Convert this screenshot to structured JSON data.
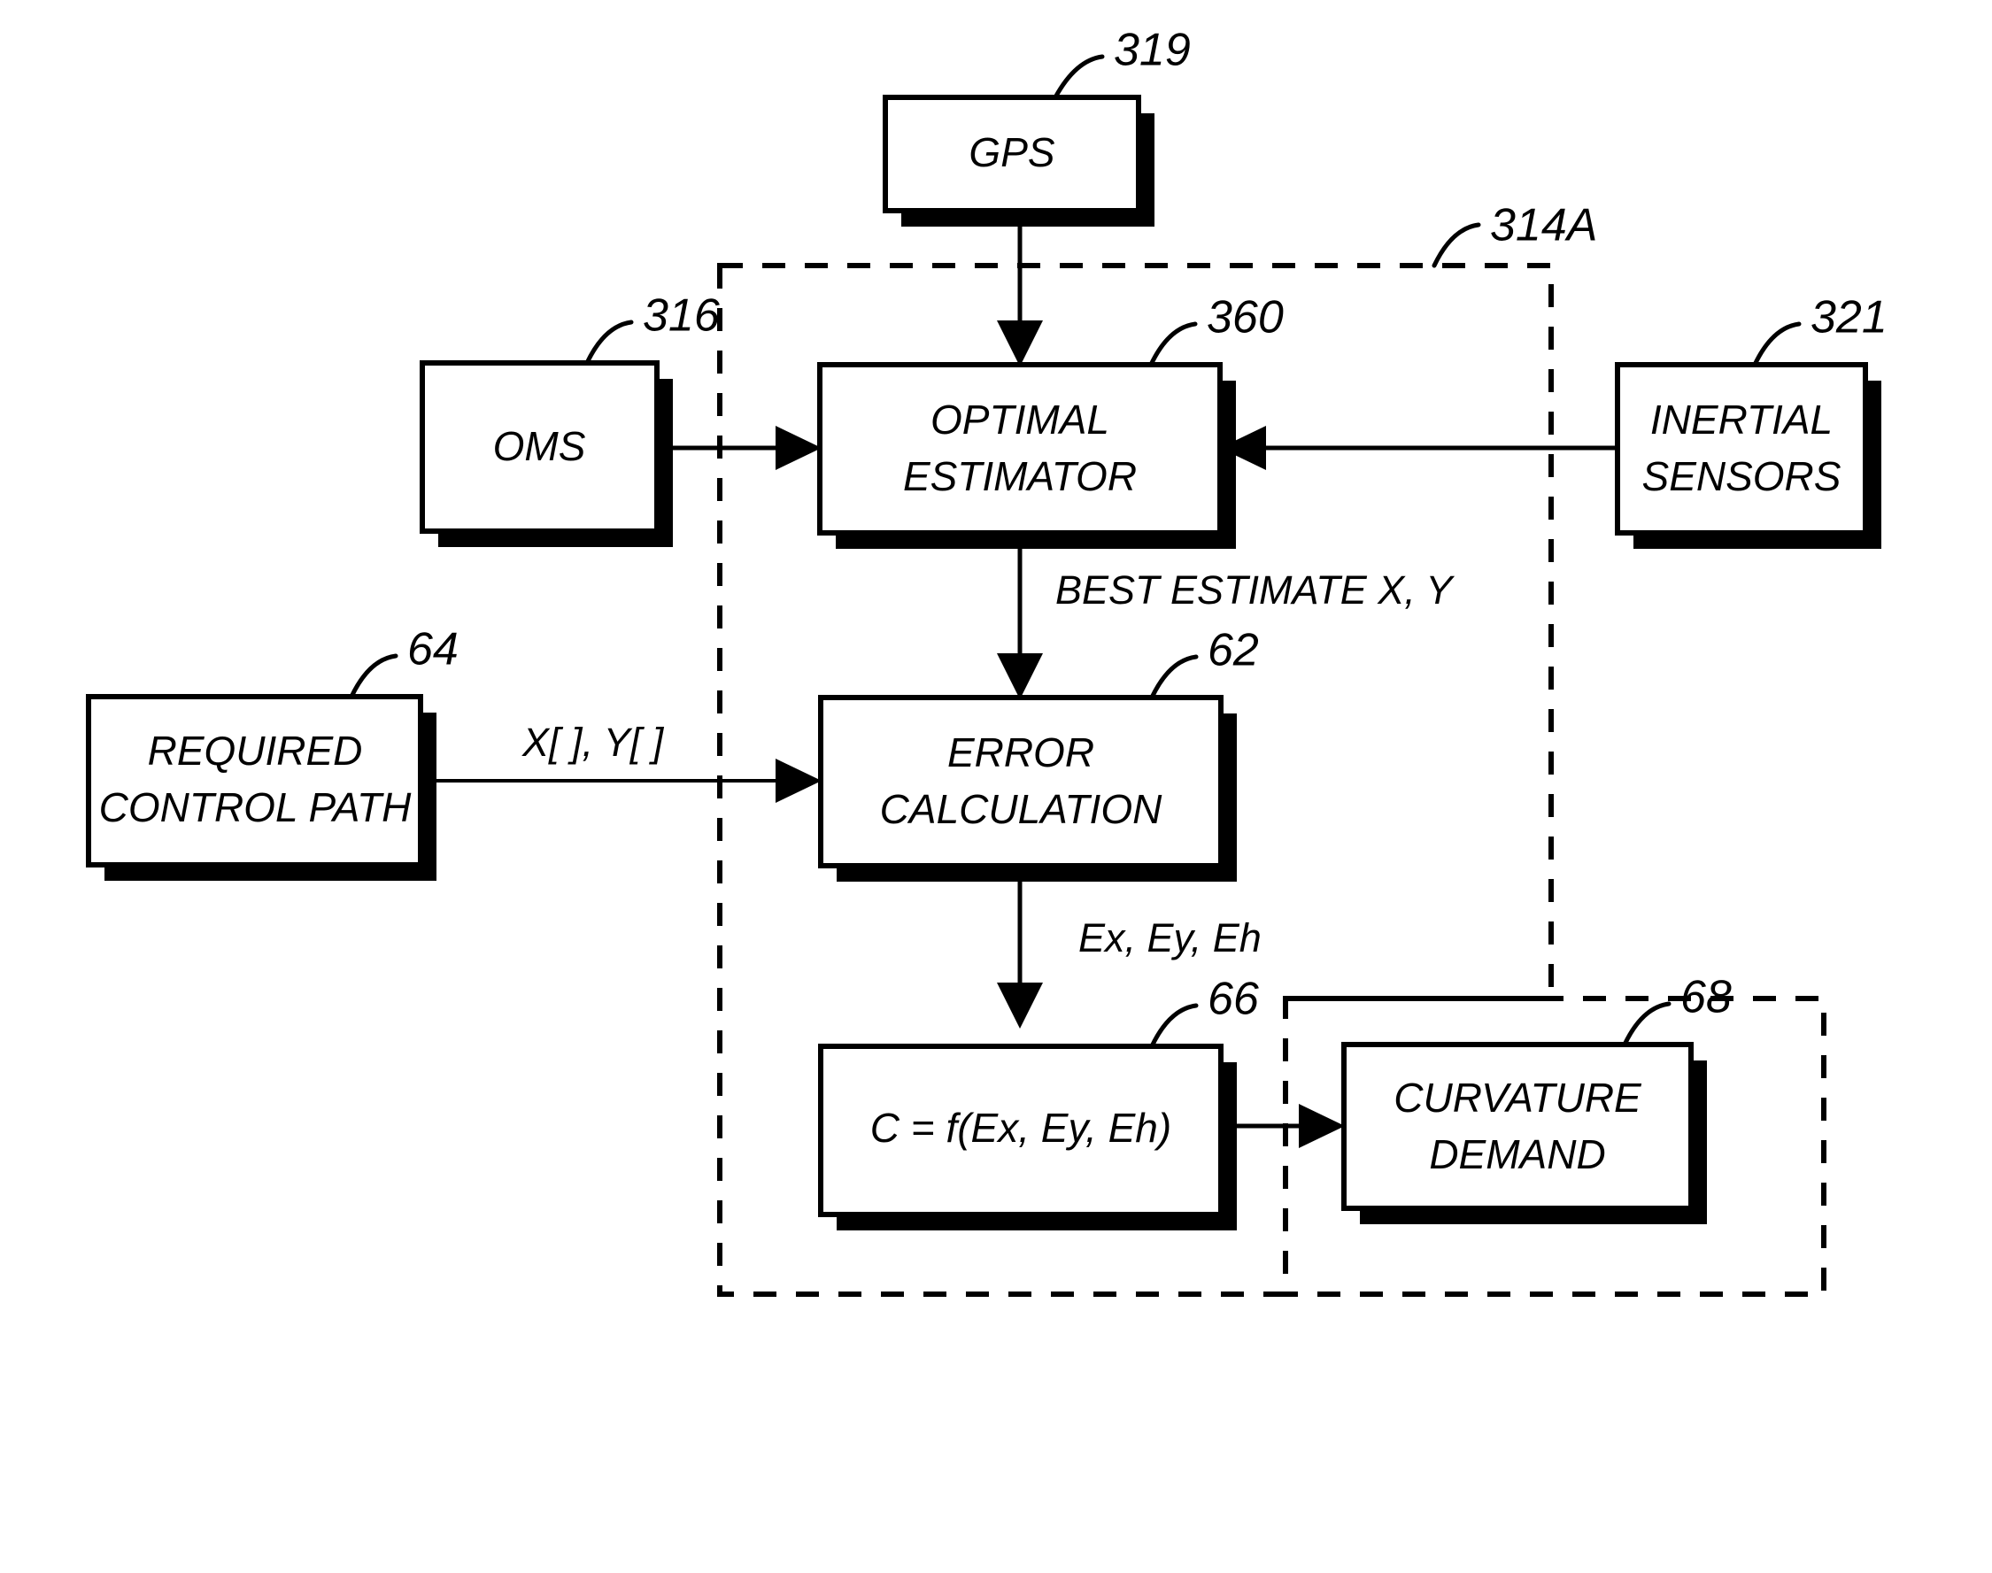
{
  "diagram": {
    "type": "block-diagram",
    "background_color": "#ffffff",
    "line_color": "#000000",
    "blocks": [
      {
        "id": "gps",
        "label": "GPS",
        "ref": "319",
        "lines": [
          "GPS"
        ]
      },
      {
        "id": "oms",
        "label": "OMS",
        "ref": "316",
        "lines": [
          "OMS"
        ]
      },
      {
        "id": "optimal-estimator",
        "label": "OPTIMAL ESTIMATOR",
        "ref": "360",
        "lines": [
          "OPTIMAL",
          "ESTIMATOR"
        ]
      },
      {
        "id": "inertial-sensors",
        "label": "INERTIAL SENSORS",
        "ref": "321",
        "lines": [
          "INERTIAL",
          "SENSORS"
        ]
      },
      {
        "id": "required-control-path",
        "label": "REQUIRED CONTROL PATH",
        "ref": "64",
        "lines": [
          "REQUIRED",
          "CONTROL PATH"
        ]
      },
      {
        "id": "error-calculation",
        "label": "ERROR CALCULATION",
        "ref": "62",
        "lines": [
          "ERROR",
          "CALCULATION"
        ]
      },
      {
        "id": "curvature-function",
        "label": "C = f(Ex, Ey, Eh)",
        "ref": "66",
        "lines": [
          "C = f(Ex, Ey, Eh)"
        ]
      },
      {
        "id": "curvature-demand",
        "label": "CURVATURE DEMAND",
        "ref": "68",
        "lines": [
          "CURVATURE",
          "DEMAND"
        ]
      }
    ],
    "signals": [
      {
        "id": "best-estimate",
        "label": "BEST ESTIMATE X, Y"
      },
      {
        "id": "path-arrays",
        "label": "X[ ], Y[ ]"
      },
      {
        "id": "error-terms",
        "label": "Ex, Ey, Eh"
      }
    ],
    "regions": [
      {
        "id": "controller-boundary",
        "ref": "314A",
        "style": "dashed"
      },
      {
        "id": "output-boundary",
        "ref": "",
        "style": "dashed"
      }
    ]
  }
}
